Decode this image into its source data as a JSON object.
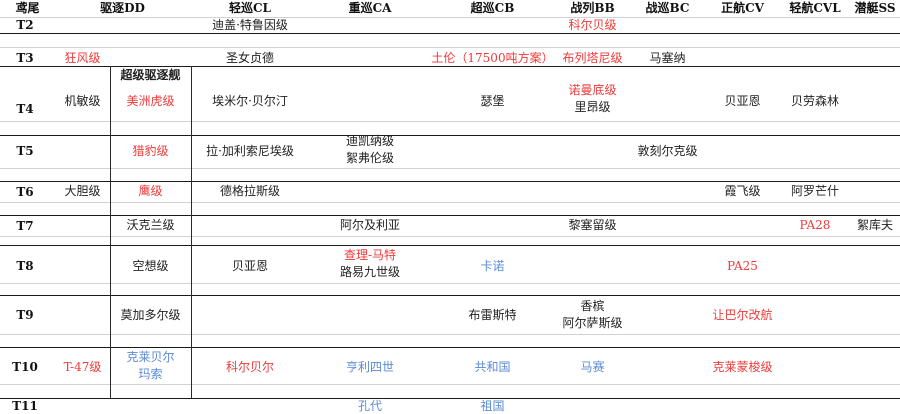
{
  "colors": {
    "red": "#f03a3a",
    "blue": "#5b8bd6",
    "text": "#222222",
    "grid": "#cfd3d8"
  },
  "header": [
    "鸢尾",
    "驱逐DD",
    "轻巡CL",
    "重巡CA",
    "超巡CB",
    "战列BB",
    "战巡BC",
    "正航CV",
    "轻航CVL",
    "潜艇SS"
  ],
  "tiers": [
    "T2",
    "T3",
    "T4",
    "T5",
    "T6",
    "T7",
    "T8",
    "T9",
    "T10",
    "T11"
  ],
  "cells": {
    "t2_cl": "迪盖·特鲁因级",
    "t2_bb": "科尔贝级",
    "t3_dd": "狂风级",
    "t3_cl": "圣女贞德",
    "t3_cb": "土伦（17500吨方案）",
    "t3_bb": "布列塔尼级",
    "t3_bc": "马塞纳",
    "t4_super_dd_label": "超级驱逐舰",
    "t4_dd": "机敏级",
    "t4_super_dd": "美洲虎级",
    "t4_cl": "埃米尔·贝尔汀",
    "t4_cb": "瑟堡",
    "t4_bb_1": "诺曼底级",
    "t4_bb_2": "里昂级",
    "t4_cv": "贝亚恩",
    "t4_cvl": "贝劳森林",
    "t5_super_dd": "猎豹级",
    "t5_cl": "拉·加利索尼埃级",
    "t5_ca_1": "迪凯纳级",
    "t5_ca_2": "絮弗伦级",
    "t5_bc": "敦刻尔克级",
    "t6_dd": "大胆级",
    "t6_super_dd": "鹰级",
    "t6_cl": "德格拉斯级",
    "t6_cv": "霞飞级",
    "t6_cvl": "阿罗芒什",
    "t7_dd": "沃克兰级",
    "t7_ca": "阿尔及利亚",
    "t7_bb": "黎塞留级",
    "t7_cvl": "PA28",
    "t7_ss": "絮库夫",
    "t8_dd": "空想级",
    "t8_cl": "贝亚恩",
    "t8_ca_1": "查理-马特",
    "t8_ca_2": "路易九世级",
    "t8_cb": "卡诺",
    "t8_cv": "PA25",
    "t9_dd": "莫加多尔级",
    "t9_cb": "布雷斯特",
    "t9_bb_1": "香槟",
    "t9_bb_2": "阿尔萨斯级",
    "t9_cv": "让巴尔改航",
    "t10_dd": "T-47级",
    "t10_super_dd_1": "克莱贝尔",
    "t10_super_dd_2": "玛索",
    "t10_cl": "科尔贝尔",
    "t10_ca": "亨利四世",
    "t10_cb": "共和国",
    "t10_bb": "马赛",
    "t10_cv": "克莱蒙梭级",
    "t11_ca": "孔代",
    "t11_cb": "祖国"
  }
}
